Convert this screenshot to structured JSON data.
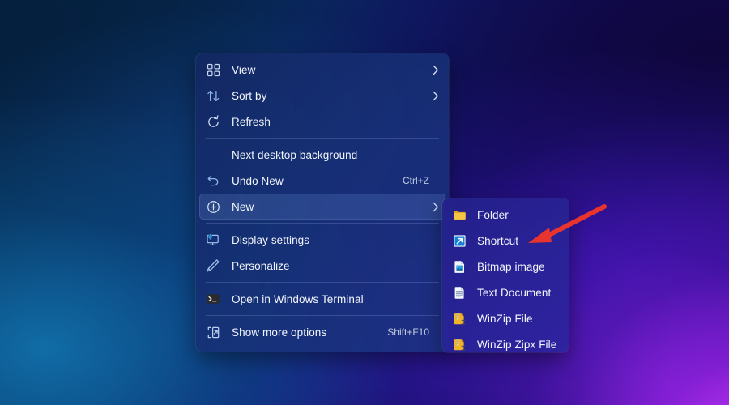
{
  "desktop": {
    "wallpaper_name": "windows-11-bloom-abstract-wallpaper",
    "colors": {
      "deep_blue": "#04203f",
      "mid_blue": "#0b2f74",
      "indigo": "#190a5e",
      "violet": "#5a17b4",
      "magenta_glow": "#d63cff",
      "cyan_glow": "#1170aa"
    }
  },
  "context_menu": {
    "name": "desktop-context-menu",
    "groups": [
      {
        "items": [
          {
            "id": "view",
            "label": "View",
            "icon": "grid-view-icon",
            "accel": "",
            "submenu": true,
            "highlight": false
          },
          {
            "id": "sort-by",
            "label": "Sort by",
            "icon": "sort-arrows-icon",
            "accel": "",
            "submenu": true,
            "highlight": false
          },
          {
            "id": "refresh",
            "label": "Refresh",
            "icon": "refresh-icon",
            "accel": "",
            "submenu": false,
            "highlight": false
          }
        ]
      },
      {
        "items": [
          {
            "id": "next-desktop-background",
            "label": "Next desktop background",
            "icon": "",
            "accel": "",
            "submenu": false,
            "highlight": false
          },
          {
            "id": "undo-new",
            "label": "Undo New",
            "icon": "undo-icon",
            "accel": "Ctrl+Z",
            "submenu": false,
            "highlight": false
          },
          {
            "id": "new",
            "label": "New",
            "icon": "plus-circle-icon",
            "accel": "",
            "submenu": true,
            "highlight": true
          }
        ]
      },
      {
        "items": [
          {
            "id": "display-settings",
            "label": "Display settings",
            "icon": "monitor-gear-icon",
            "accel": "",
            "submenu": false,
            "highlight": false
          },
          {
            "id": "personalize",
            "label": "Personalize",
            "icon": "pen-icon",
            "accel": "",
            "submenu": false,
            "highlight": false
          }
        ]
      },
      {
        "items": [
          {
            "id": "open-in-windows-terminal",
            "label": "Open in Windows Terminal",
            "icon": "terminal-icon",
            "accel": "",
            "submenu": false,
            "highlight": false
          }
        ]
      },
      {
        "items": [
          {
            "id": "show-more-options",
            "label": "Show more options",
            "icon": "show-more-options-icon",
            "accel": "Shift+F10",
            "submenu": false,
            "highlight": false
          }
        ]
      }
    ]
  },
  "new_submenu": {
    "name": "new-submenu",
    "items": [
      {
        "id": "folder",
        "label": "Folder",
        "icon": "folder-icon"
      },
      {
        "id": "shortcut",
        "label": "Shortcut",
        "icon": "shortcut-icon"
      },
      {
        "id": "bitmap-image",
        "label": "Bitmap image",
        "icon": "bitmap-image-icon"
      },
      {
        "id": "text-document",
        "label": "Text Document",
        "icon": "text-document-icon"
      },
      {
        "id": "winzip-file",
        "label": "WinZip File",
        "icon": "winzip-file-icon"
      },
      {
        "id": "winzip-zipx-file",
        "label": "WinZip Zipx File",
        "icon": "winzip-zipx-file-icon"
      }
    ]
  },
  "annotation": {
    "name": "red-arrow-pointing-to-shortcut",
    "color": "#e8342e",
    "points_to": "Shortcut"
  }
}
